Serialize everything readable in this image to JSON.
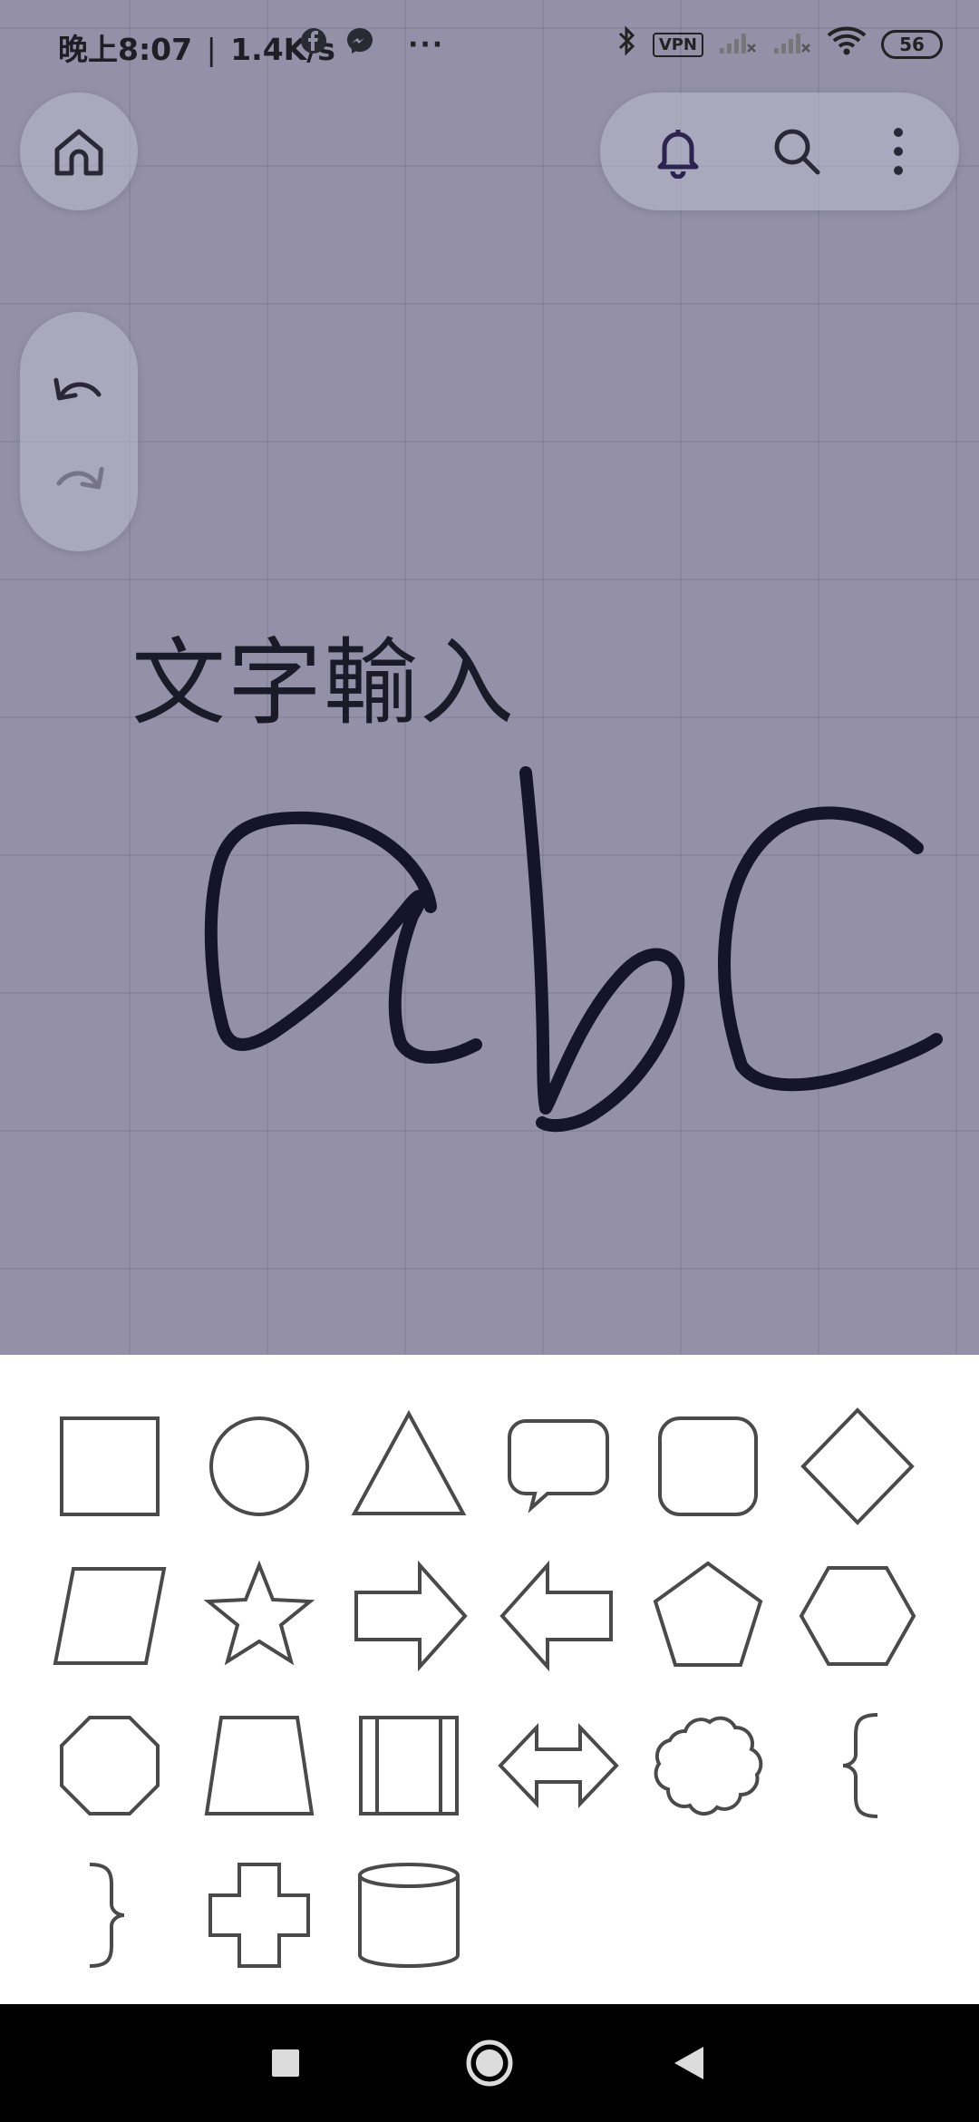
{
  "status_bar": {
    "time": "晚上8:07",
    "network_speed": "1.4K/s",
    "separator": "|",
    "vpn_label": "VPN",
    "battery_level": "56",
    "icons": [
      "facebook-icon",
      "messenger-icon",
      "more-dots-icon",
      "bluetooth-icon",
      "vpn-icon",
      "signal-icon",
      "signal-icon",
      "wifi-icon",
      "battery-icon"
    ]
  },
  "toolbar": {
    "home_icon": "home-icon",
    "notification_icon": "bell-icon",
    "search_icon": "search-icon",
    "menu_icon": "more-vertical-icon",
    "undo_icon": "undo-icon",
    "redo_icon": "redo-icon"
  },
  "canvas": {
    "typed_text": "文字輸入",
    "handwriting": "abc",
    "background_color": "#9390a8",
    "ink_color": "#15142a"
  },
  "shape_panel": {
    "shapes": [
      "square",
      "circle",
      "triangle",
      "speech-bubble",
      "rounded-rectangle",
      "diamond",
      "parallelogram",
      "star",
      "right-arrow",
      "left-arrow",
      "pentagon",
      "hexagon",
      "octagon",
      "trapezoid",
      "predefined-process",
      "double-arrow",
      "cloud",
      "left-brace",
      "right-brace",
      "cross",
      "cylinder"
    ]
  },
  "nav_bar": {
    "buttons": [
      "recents-button",
      "home-button",
      "back-button"
    ]
  }
}
